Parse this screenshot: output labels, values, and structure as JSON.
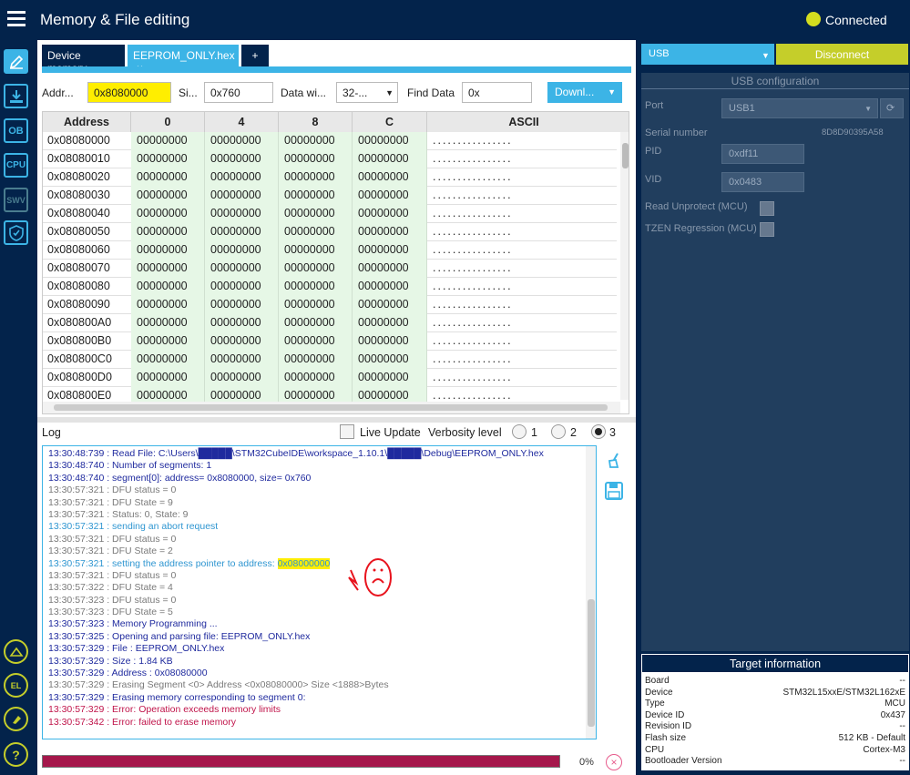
{
  "header": {
    "title": "Memory & File editing",
    "status": "Connected"
  },
  "leftnav": {
    "items": [
      "OB",
      "CPU",
      "SWV"
    ]
  },
  "tabs": [
    {
      "label": "Device memory"
    },
    {
      "label": "EEPROM_ONLY.hex",
      "close": "×"
    },
    {
      "label": "+"
    }
  ],
  "toolbar": {
    "addr_label": "Addr...",
    "addr_value": "0x8080000",
    "size_label": "Si...",
    "size_value": "0x760",
    "width_label": "Data wi...",
    "width_value": "32-...",
    "find_label": "Find Data",
    "find_value": "0x",
    "download_label": "Downl..."
  },
  "grid": {
    "headers": [
      "Address",
      "0",
      "4",
      "8",
      "C",
      "ASCII"
    ],
    "rows": [
      [
        "0x08080000",
        "00000000",
        "00000000",
        "00000000",
        "00000000",
        "................"
      ],
      [
        "0x08080010",
        "00000000",
        "00000000",
        "00000000",
        "00000000",
        "................"
      ],
      [
        "0x08080020",
        "00000000",
        "00000000",
        "00000000",
        "00000000",
        "................"
      ],
      [
        "0x08080030",
        "00000000",
        "00000000",
        "00000000",
        "00000000",
        "................"
      ],
      [
        "0x08080040",
        "00000000",
        "00000000",
        "00000000",
        "00000000",
        "................"
      ],
      [
        "0x08080050",
        "00000000",
        "00000000",
        "00000000",
        "00000000",
        "................"
      ],
      [
        "0x08080060",
        "00000000",
        "00000000",
        "00000000",
        "00000000",
        "................"
      ],
      [
        "0x08080070",
        "00000000",
        "00000000",
        "00000000",
        "00000000",
        "................"
      ],
      [
        "0x08080080",
        "00000000",
        "00000000",
        "00000000",
        "00000000",
        "................"
      ],
      [
        "0x08080090",
        "00000000",
        "00000000",
        "00000000",
        "00000000",
        "................"
      ],
      [
        "0x080800A0",
        "00000000",
        "00000000",
        "00000000",
        "00000000",
        "................"
      ],
      [
        "0x080800B0",
        "00000000",
        "00000000",
        "00000000",
        "00000000",
        "................"
      ],
      [
        "0x080800C0",
        "00000000",
        "00000000",
        "00000000",
        "00000000",
        "................"
      ],
      [
        "0x080800D0",
        "00000000",
        "00000000",
        "00000000",
        "00000000",
        "................"
      ],
      [
        "0x080800E0",
        "00000000",
        "00000000",
        "00000000",
        "00000000",
        "................"
      ]
    ]
  },
  "log": {
    "label": "Log",
    "live_update": "Live Update",
    "verbosity": "Verbosity level",
    "levels": [
      "1",
      "2",
      "3"
    ],
    "selected_level": "3",
    "lines": [
      {
        "text": "13:30:48:739 : Read File: C:\\Users\\█████\\STM32CubeIDE\\workspace_1.10.1\\█████\\Debug\\EEPROM_ONLY.hex",
        "color": "blue"
      },
      {
        "text": "13:30:48:740 : Number of segments: 1",
        "color": "blue"
      },
      {
        "text": "13:30:48:740 : segment[0]: address= 0x8080000, size= 0x760",
        "color": "blue"
      },
      {
        "text": "13:30:57:321 : DFU status = 0",
        "color": "gray"
      },
      {
        "text": "13:30:57:321 : DFU State = 9",
        "color": "gray"
      },
      {
        "text": "13:30:57:321 : Status: 0, State: 9",
        "color": "gray"
      },
      {
        "text": "13:30:57:321 : sending an abort request",
        "color": "cyan"
      },
      {
        "text": "13:30:57:321 : DFU status = 0",
        "color": "gray"
      },
      {
        "text": "13:30:57:321 : DFU State = 2",
        "color": "gray"
      },
      {
        "text": "13:30:57:321 : setting the address pointer to address: ",
        "color": "cyan",
        "highlight": "0x08000000"
      },
      {
        "text": "13:30:57:321 : DFU status = 0",
        "color": "gray"
      },
      {
        "text": "13:30:57:322 : DFU State = 4",
        "color": "gray"
      },
      {
        "text": "13:30:57:323 : DFU status = 0",
        "color": "gray"
      },
      {
        "text": "13:30:57:323 : DFU State = 5",
        "color": "gray"
      },
      {
        "text": "13:30:57:323 : Memory Programming ...",
        "color": "blue"
      },
      {
        "text": "13:30:57:325 : Opening and parsing file: EEPROM_ONLY.hex",
        "color": "blue"
      },
      {
        "text": "13:30:57:329 :   File          : EEPROM_ONLY.hex",
        "color": "blue"
      },
      {
        "text": "13:30:57:329 :   Size          : 1.84 KB",
        "color": "blue"
      },
      {
        "text": "13:30:57:329 :   Address       : 0x08080000",
        "color": "blue"
      },
      {
        "text": "13:30:57:329 : Erasing Segment <0> Address <0x08080000> Size <1888>Bytes",
        "color": "gray"
      },
      {
        "text": "13:30:57:329 : Erasing memory corresponding to segment 0:",
        "color": "blue"
      },
      {
        "text": "13:30:57:329 : Error: Operation exceeds memory limits",
        "color": "red"
      },
      {
        "text": "13:30:57:342 : Error: failed to erase memory",
        "color": "red"
      }
    ]
  },
  "progress": {
    "value": 1.0,
    "percent_text": "0%"
  },
  "right": {
    "interface": "USB",
    "disconnect": "Disconnect",
    "config_title": "USB configuration",
    "port_label": "Port",
    "port_value": "USB1",
    "serial_label": "Serial number",
    "serial_value": "8D8D90395A58",
    "pid_label": "PID",
    "pid_value": "0xdf11",
    "vid_label": "VID",
    "vid_value": "0x0483",
    "read_unprotect": "Read Unprotect (MCU)",
    "tzen": "TZEN Regression (MCU)"
  },
  "target": {
    "title": "Target information",
    "rows": [
      {
        "k": "Board",
        "v": "--"
      },
      {
        "k": "Device",
        "v": "STM32L15xxE/STM32L162xE"
      },
      {
        "k": "Type",
        "v": "MCU"
      },
      {
        "k": "Device ID",
        "v": "0x437"
      },
      {
        "k": "Revision ID",
        "v": "--"
      },
      {
        "k": "Flash size",
        "v": "512 KB - Default"
      },
      {
        "k": "CPU",
        "v": "Cortex-M3"
      },
      {
        "k": "Bootloader Version",
        "v": "--"
      }
    ]
  },
  "colors": {
    "accent": "#3cb4e6",
    "navy": "#03234b",
    "lime": "#c5ce2a",
    "highlight": "#ffee00",
    "error": "#c0144a"
  }
}
